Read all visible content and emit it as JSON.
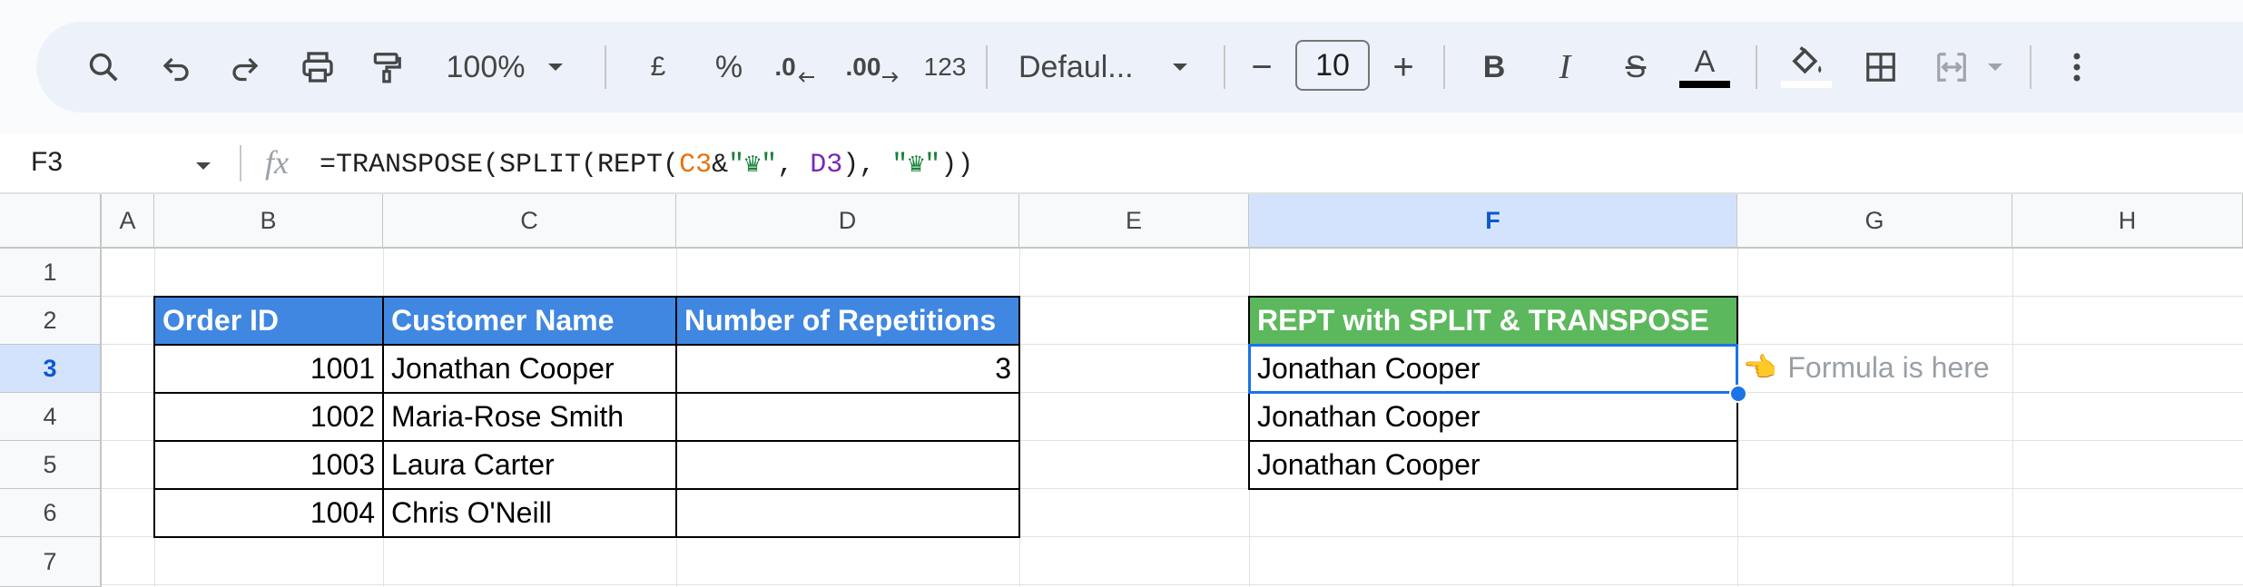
{
  "toolbar": {
    "zoom": "100%",
    "currency_label": "£",
    "percent_label": "%",
    "decrease_decimal_label": ".0",
    "increase_decimal_label": ".00",
    "number_format_label": "123",
    "font_name": "Defaul...",
    "font_size": "10",
    "bold_label": "B",
    "italic_label": "I",
    "strike_label": "S",
    "text_color_label": "A",
    "minus_label": "−",
    "plus_label": "+"
  },
  "formula_bar": {
    "name_box": "F3",
    "fx_label": "fx",
    "formula_parts": [
      "=TRANSPOSE(SPLIT(REPT(",
      "C3",
      "&",
      "\"♛\"",
      ", ",
      "D3",
      "), ",
      "\"♛\"",
      "))"
    ]
  },
  "columns": [
    "A",
    "B",
    "C",
    "D",
    "E",
    "F",
    "G",
    "H"
  ],
  "rows": [
    "1",
    "2",
    "3",
    "4",
    "5",
    "6",
    "7"
  ],
  "table": {
    "headers": [
      "Order ID",
      "Customer Name",
      "Number of Repetitions"
    ],
    "rows": [
      [
        "1001",
        "Jonathan Cooper",
        "3"
      ],
      [
        "1002",
        "Maria-Rose Smith",
        ""
      ],
      [
        "1003",
        "Laura Carter",
        ""
      ],
      [
        "1004",
        "Chris O'Neill",
        ""
      ]
    ]
  },
  "result": {
    "header": "REPT with SPLIT & TRANSPOSE",
    "values": [
      "Jonathan Cooper",
      "Jonathan Cooper",
      "Jonathan Cooper"
    ]
  },
  "note": {
    "pointer": "👈",
    "text": "Formula is here"
  },
  "colors": {
    "header_blue": "#3f87e1",
    "header_green": "#5cb85c",
    "selection": "#1a73e8",
    "ref_c3": "#e8710a",
    "ref_d3": "#7627bb",
    "string_green": "#188038"
  }
}
